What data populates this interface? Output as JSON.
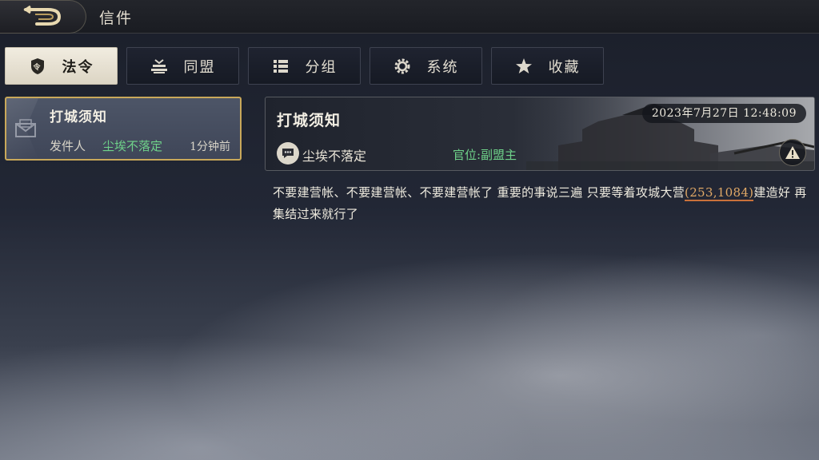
{
  "topbar": {
    "title": "信件"
  },
  "tabs": [
    {
      "label": "法令",
      "icon": "edict-shield-icon",
      "active": true
    },
    {
      "label": "同盟",
      "icon": "alliance-icon",
      "active": false
    },
    {
      "label": "分组",
      "icon": "list-icon",
      "active": false
    },
    {
      "label": "系统",
      "icon": "gear-icon",
      "active": false
    },
    {
      "label": "收藏",
      "icon": "star-icon",
      "active": false
    }
  ],
  "mail_list": [
    {
      "subject": "打城须知",
      "sender_label": "发件人",
      "sender": "尘埃不落定",
      "time_ago": "1分钟前",
      "selected": true
    }
  ],
  "mail_detail": {
    "subject": "打城须知",
    "datetime": "2023年7月27日  12:48:09",
    "sender": "尘埃不落定",
    "rank": "官位:副盟主",
    "body_before": "不要建营帐、不要建营帐、不要建营帐了 重要的事说三遍  只要等着攻城大营",
    "coordinate": "(253,1084)",
    "body_after": "建造好 再集结过来就行了"
  },
  "colors": {
    "accent_gold": "#c9a85a",
    "sender_green": "#6fd38a",
    "link_orange": "#e0a866"
  }
}
